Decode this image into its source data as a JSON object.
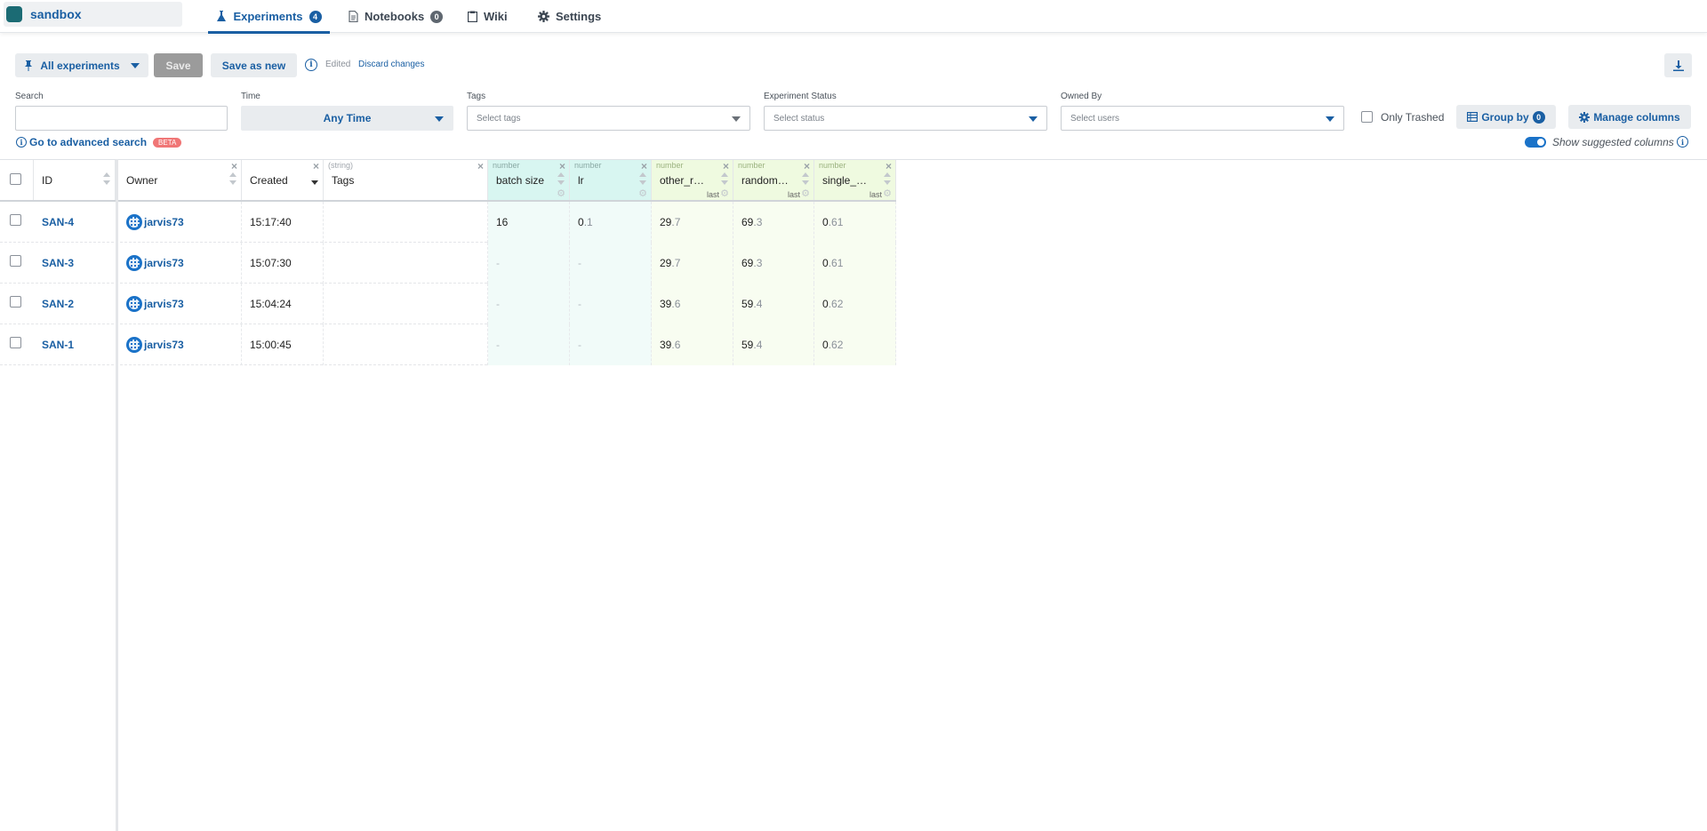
{
  "project": {
    "name": "sandbox",
    "color": "#1b6b74"
  },
  "nav": {
    "tabs": [
      {
        "label": "Experiments",
        "count": "4",
        "icon": "flask-icon"
      },
      {
        "label": "Notebooks",
        "count": "0",
        "icon": "notebook-icon"
      },
      {
        "label": "Wiki",
        "icon": "clipboard-icon"
      },
      {
        "label": "Settings",
        "icon": "gear-icon"
      }
    ]
  },
  "toolbar": {
    "view_label": "All experiments",
    "save_label": "Save",
    "save_as_new_label": "Save as new",
    "edited_text": "Edited",
    "discard_label": "Discard changes"
  },
  "filters": {
    "search": {
      "label": "Search",
      "value": "",
      "placeholder": ""
    },
    "time": {
      "label": "Time",
      "value": "Any Time"
    },
    "tags": {
      "label": "Tags",
      "placeholder": "Select tags"
    },
    "status": {
      "label": "Experiment Status",
      "placeholder": "Select status"
    },
    "owner": {
      "label": "Owned By",
      "placeholder": "Select users"
    },
    "only_trashed_label": "Only Trashed",
    "group_by_label": "Group by",
    "group_by_count": "0",
    "manage_columns_label": "Manage columns",
    "advanced_search_label": "Go to advanced search",
    "beta_label": "BETA",
    "show_suggested_label": "Show suggested columns"
  },
  "table": {
    "columns": {
      "id": "ID",
      "owner": "Owner",
      "created": "Created",
      "tags": {
        "title": "Tags",
        "type": "(string)"
      },
      "batch_size": {
        "title": "batch size",
        "type": "number"
      },
      "lr": {
        "title": "lr",
        "type": "number"
      },
      "other": {
        "title": "other_r…",
        "type": "number",
        "agg": "last"
      },
      "random": {
        "title": "random…",
        "type": "number",
        "agg": "last"
      },
      "single": {
        "title": "single_…",
        "type": "number",
        "agg": "last"
      }
    },
    "rows": [
      {
        "id": "SAN-4",
        "owner": "jarvis73",
        "created": "15:17:40",
        "batch_size": "16",
        "lr_int": "0",
        "lr_frac": ".1",
        "other_int": "29",
        "other_frac": ".7",
        "random_int": "69",
        "random_frac": ".3",
        "single_int": "0",
        "single_frac": ".61"
      },
      {
        "id": "SAN-3",
        "owner": "jarvis73",
        "created": "15:07:30",
        "batch_size": "-",
        "lr": "-",
        "other_int": "29",
        "other_frac": ".7",
        "random_int": "69",
        "random_frac": ".3",
        "single_int": "0",
        "single_frac": ".61"
      },
      {
        "id": "SAN-2",
        "owner": "jarvis73",
        "created": "15:04:24",
        "batch_size": "-",
        "lr": "-",
        "other_int": "39",
        "other_frac": ".6",
        "random_int": "59",
        "random_frac": ".4",
        "single_int": "0",
        "single_frac": ".62"
      },
      {
        "id": "SAN-1",
        "owner": "jarvis73",
        "created": "15:00:45",
        "batch_size": "-",
        "lr": "-",
        "other_int": "39",
        "other_frac": ".6",
        "random_int": "59",
        "random_frac": ".4",
        "single_int": "0",
        "single_frac": ".62"
      }
    ]
  }
}
